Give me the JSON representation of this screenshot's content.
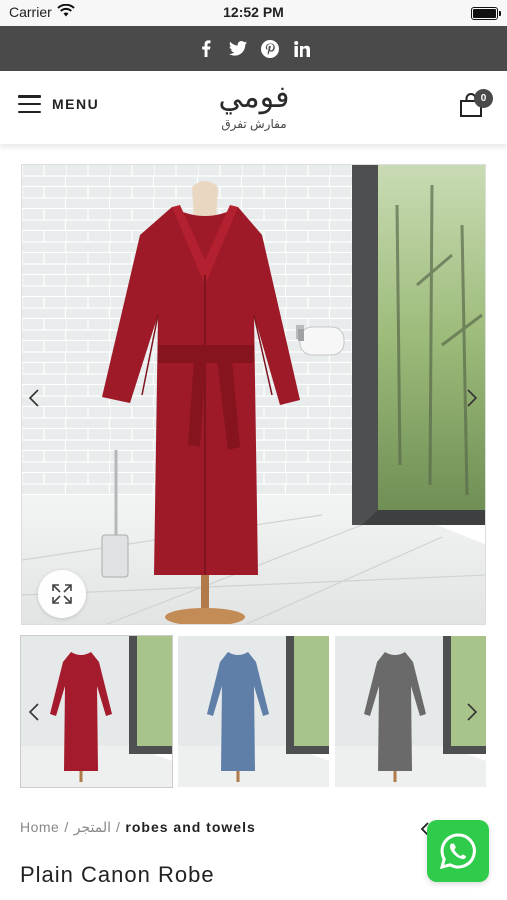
{
  "status_bar": {
    "carrier": "Carrier",
    "time": "12:52 PM"
  },
  "social": {
    "icons": [
      "facebook-icon",
      "twitter-icon",
      "pinterest-icon",
      "linkedin-icon"
    ],
    "color": "#4a4a4a"
  },
  "header": {
    "menu_label": "MENU",
    "logo_main": "فومي",
    "logo_sub": "مفارش تفرق",
    "cart_count": "0"
  },
  "gallery": {
    "main_alt": "Red robe on mannequin",
    "thumbnails": [
      {
        "name": "red",
        "color": "#a31b2c"
      },
      {
        "name": "blue",
        "color": "#5f7fa8"
      },
      {
        "name": "gray",
        "color": "#6a6a6a"
      }
    ]
  },
  "breadcrumb": {
    "home": "Home",
    "sep1": "/",
    "shop": "المتجر",
    "sep2": "/",
    "current": "robes and towels"
  },
  "product": {
    "title": "Plain Canon Robe"
  },
  "colors": {
    "dark_bar": "#4a4a4a",
    "whatsapp": "#2fcc4c"
  }
}
